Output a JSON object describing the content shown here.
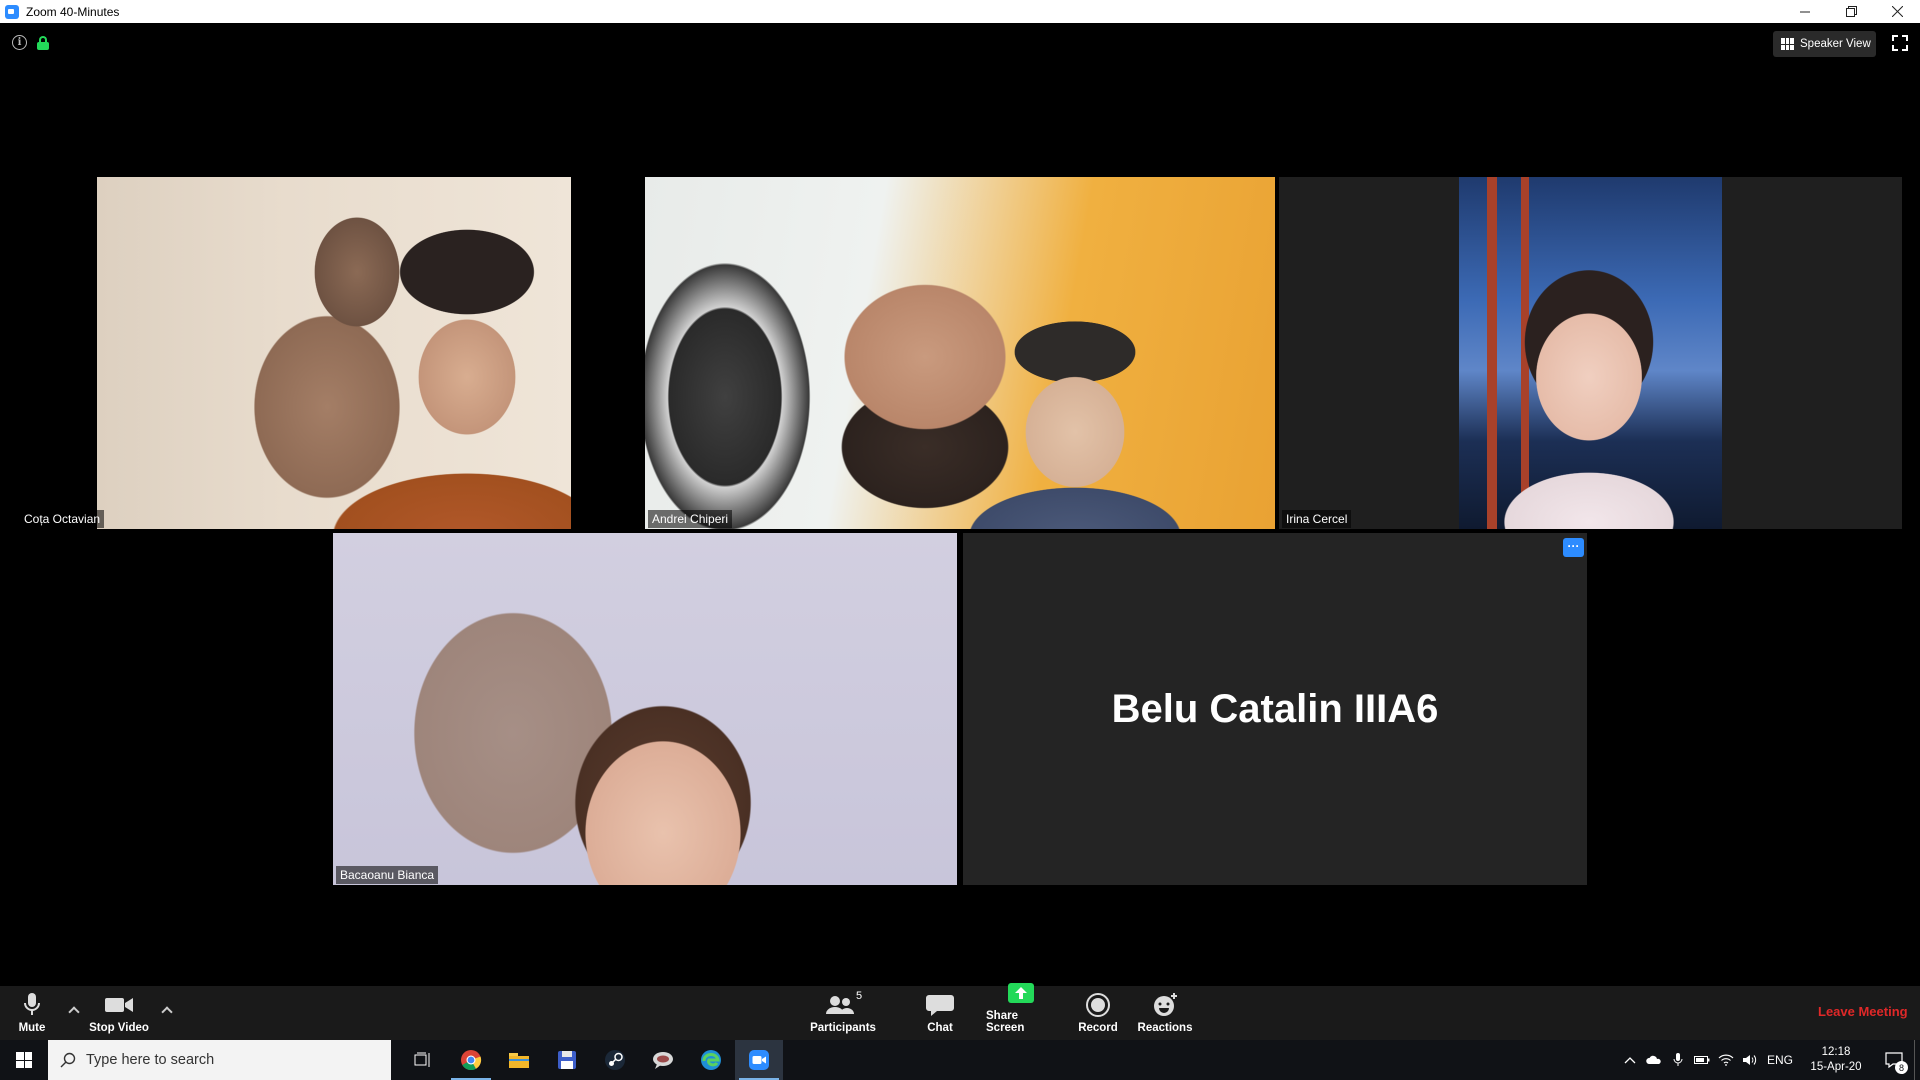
{
  "window": {
    "title": "Zoom 40-Minutes",
    "controls": [
      "minimize-icon",
      "restore-icon",
      "close-icon"
    ]
  },
  "meeting": {
    "speaker_view_label": "Speaker View",
    "participants": [
      {
        "name": "Coța Octavian",
        "active": false
      },
      {
        "name": "Andrei Chiperi",
        "active": true
      },
      {
        "name": "Irina Cercel",
        "active": false
      },
      {
        "name": "Bacaoanu Bianca",
        "active": false
      },
      {
        "name": "Belu Catalin IIIA6",
        "active": false,
        "video": "off"
      }
    ],
    "more_label": "···"
  },
  "toolbar": {
    "mute_label": "Mute",
    "stop_video_label": "Stop Video",
    "participants_label": "Participants",
    "participants_count": "5",
    "chat_label": "Chat",
    "share_screen_label": "Share Screen",
    "record_label": "Record",
    "reactions_label": "Reactions",
    "leave_label": "Leave Meeting"
  },
  "taskbar": {
    "search_placeholder": "Type here to search",
    "language": "ENG",
    "time": "12:18",
    "date": "15-Apr-20",
    "notification_count": "8",
    "apps": [
      "task-view-icon",
      "chrome-icon",
      "file-explorer-icon",
      "floppy-save-icon",
      "steam-icon",
      "chat-app-icon",
      "edge-icon",
      "zoom-icon"
    ]
  },
  "colors": {
    "zoom_blue": "#2D8CFF",
    "active_speaker_border": "#d9f26a",
    "leave_red": "#e02828",
    "share_green": "#23d959"
  }
}
